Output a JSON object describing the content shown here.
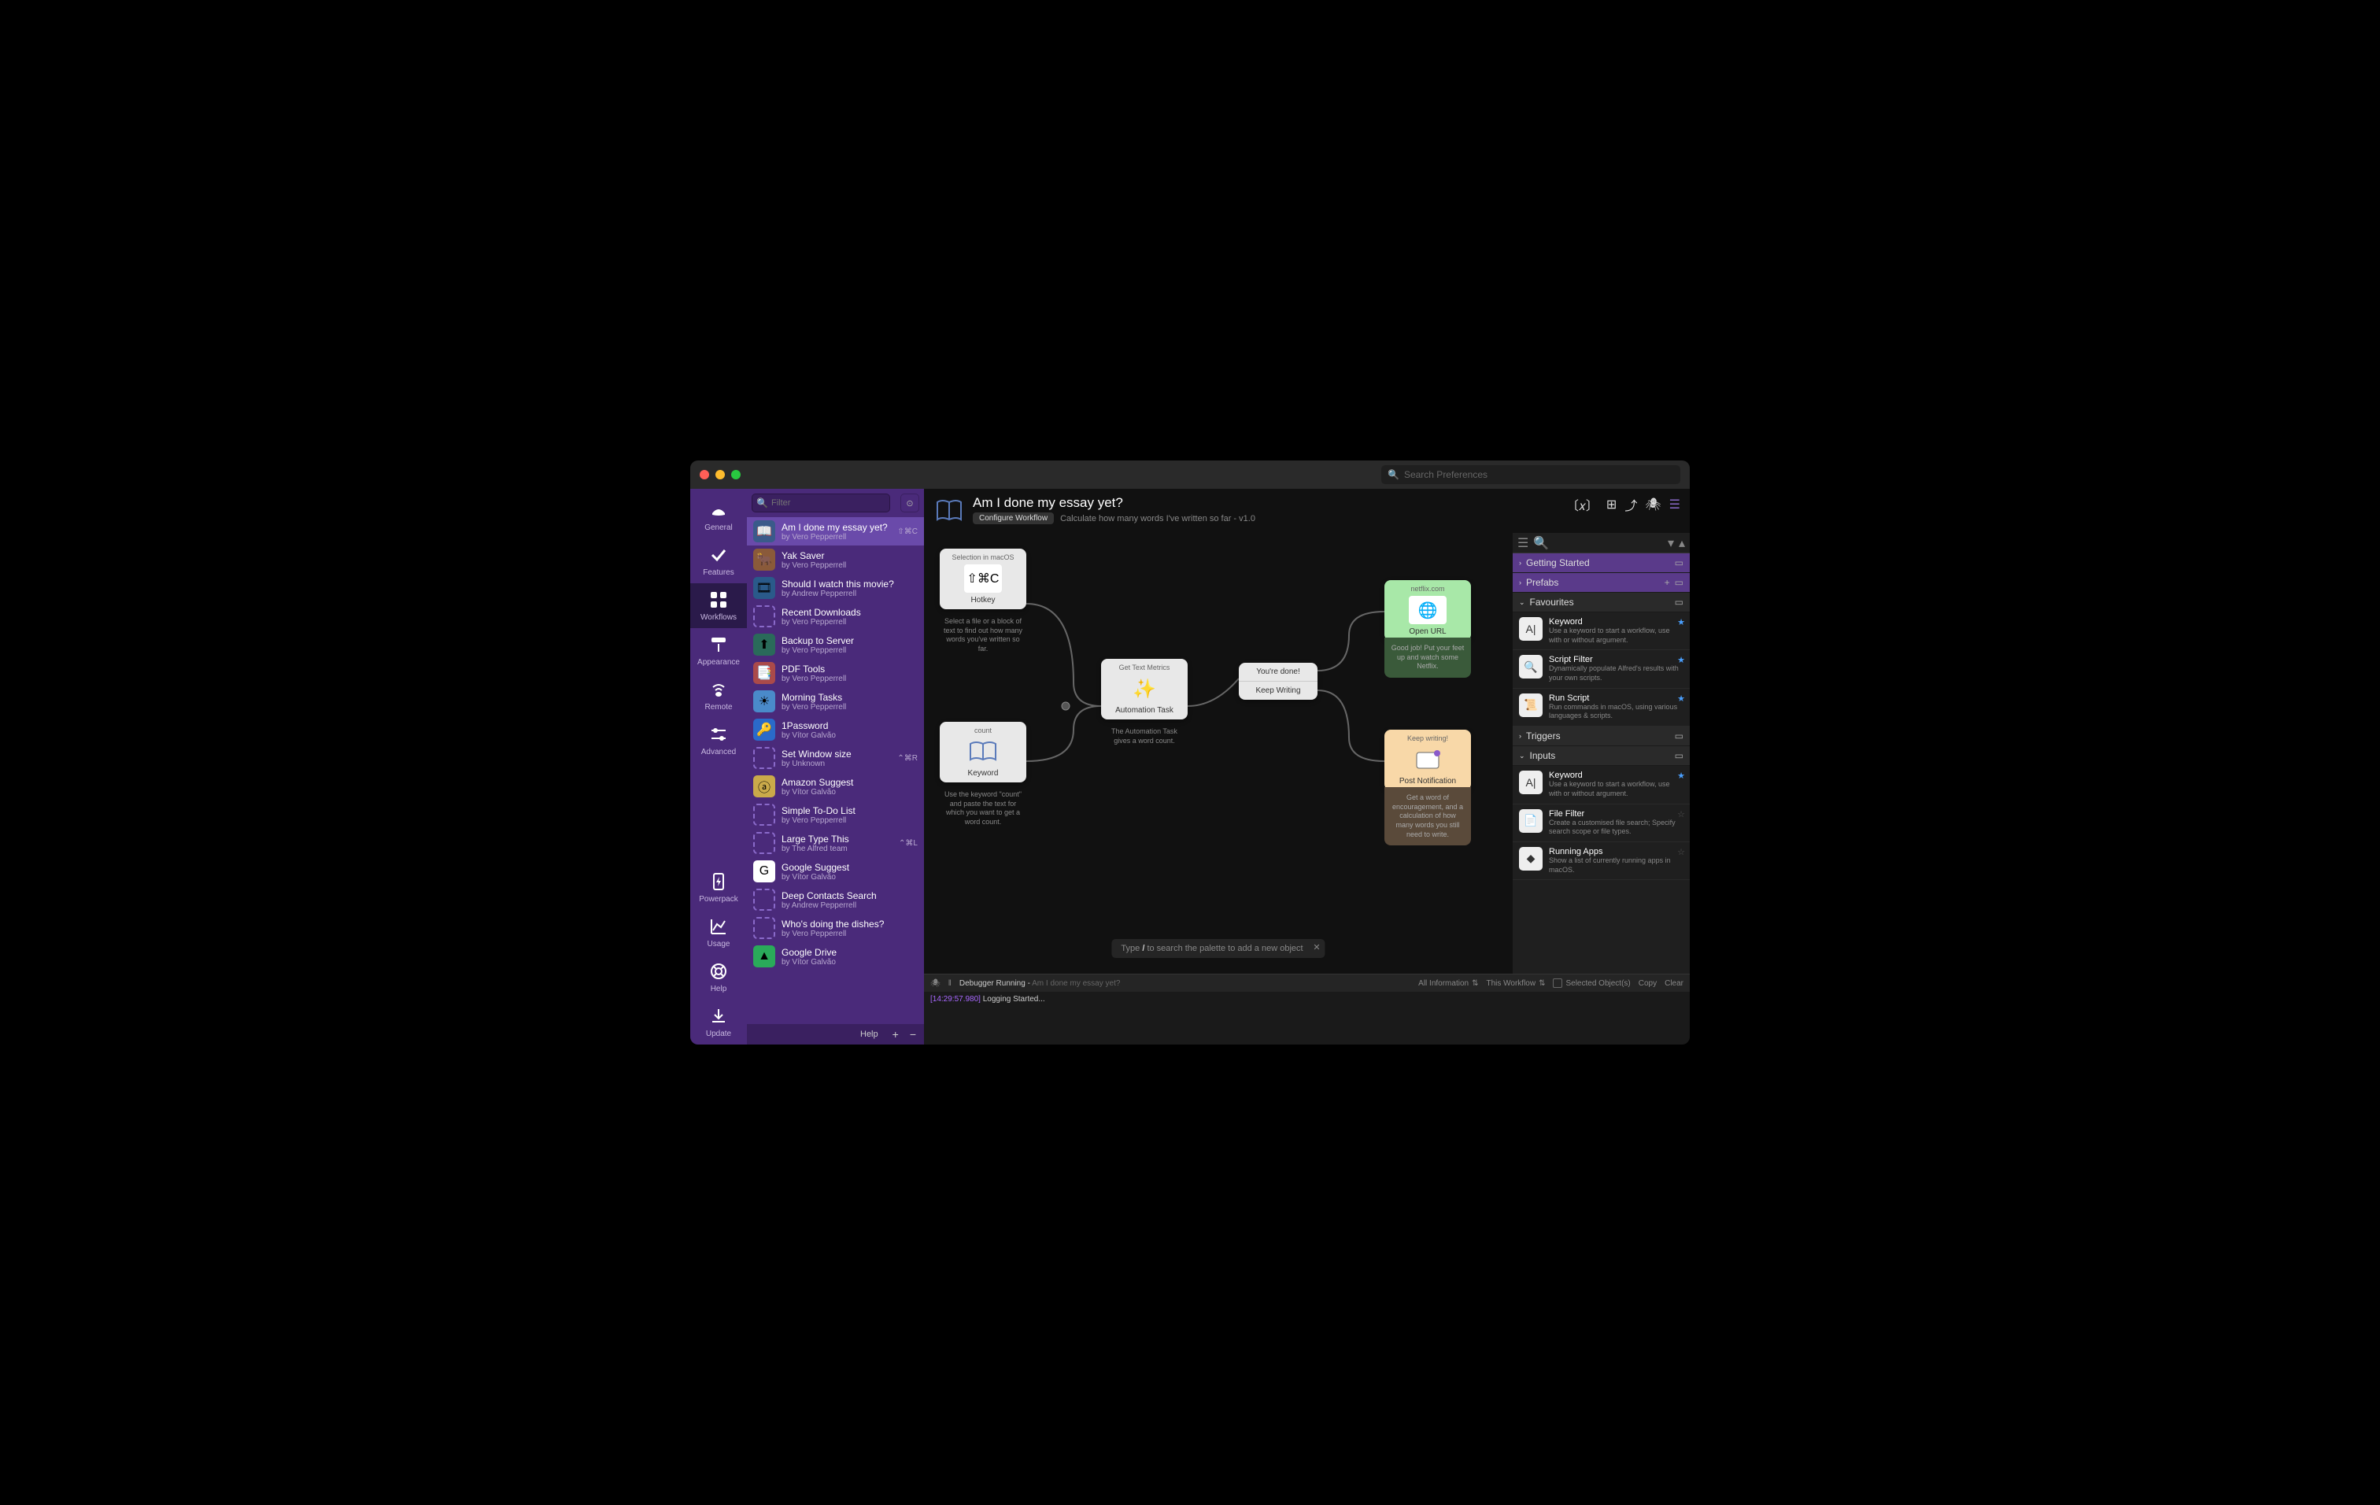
{
  "titlebar": {
    "search_placeholder": "Search Preferences"
  },
  "nav": [
    {
      "label": "General",
      "icon": "hat"
    },
    {
      "label": "Features",
      "icon": "check"
    },
    {
      "label": "Workflows",
      "icon": "grid",
      "active": true
    },
    {
      "label": "Appearance",
      "icon": "roller"
    },
    {
      "label": "Remote",
      "icon": "wifi"
    },
    {
      "label": "Advanced",
      "icon": "sliders"
    }
  ],
  "nav_bottom": [
    {
      "label": "Powerpack",
      "icon": "bolt"
    },
    {
      "label": "Usage",
      "icon": "chart"
    },
    {
      "label": "Help",
      "icon": "life"
    },
    {
      "label": "Update",
      "icon": "download"
    }
  ],
  "sidebar": {
    "filter_placeholder": "Filter",
    "help_label": "Help",
    "workflows": [
      {
        "title": "Am I done my essay yet?",
        "author": "by Vero Pepperrell",
        "icon": "book",
        "color": "#3a5a8a",
        "shortcut": "⇧⌘C",
        "selected": true
      },
      {
        "title": "Yak Saver",
        "author": "by Vero Pepperrell",
        "icon": "yak",
        "color": "#8a5a3a"
      },
      {
        "title": "Should I watch this movie?",
        "author": "by Andrew Pepperrell",
        "icon": "film",
        "color": "#2a5a8a"
      },
      {
        "title": "Recent Downloads",
        "author": "by Vero Pepperrell",
        "icon": "dashed"
      },
      {
        "title": "Backup to Server",
        "author": "by Vero Pepperrell",
        "icon": "upload",
        "color": "#2a6a5a"
      },
      {
        "title": "PDF Tools",
        "author": "by Vero Pepperrell",
        "icon": "pdf",
        "color": "#aa4a4a"
      },
      {
        "title": "Morning Tasks",
        "author": "by Vero Pepperrell",
        "icon": "sun",
        "color": "#4a8aca"
      },
      {
        "title": "1Password",
        "author": "by Vítor Galvão",
        "icon": "1p",
        "color": "#2a6aca"
      },
      {
        "title": "Set Window size",
        "author": "by Unknown",
        "icon": "dashed",
        "shortcut": "⌃⌘R"
      },
      {
        "title": "Amazon Suggest",
        "author": "by Vítor Galvão",
        "icon": "amazon",
        "color": "#caaa4a"
      },
      {
        "title": "Simple To-Do List",
        "author": "by Vero Pepperrell",
        "icon": "dashed"
      },
      {
        "title": "Large Type This",
        "author": "by The Alfred team",
        "icon": "dashed",
        "shortcut": "⌃⌘L"
      },
      {
        "title": "Google Suggest",
        "author": "by Vítor Galvão",
        "icon": "google",
        "color": "#fff"
      },
      {
        "title": "Deep Contacts Search",
        "author": "by Andrew Pepperrell",
        "icon": "dashed"
      },
      {
        "title": "Who's doing the dishes?",
        "author": "by Vero Pepperrell",
        "icon": "dashed"
      },
      {
        "title": "Google Drive",
        "author": "by Vítor Galvão",
        "icon": "drive",
        "color": "#2aaa5a"
      }
    ]
  },
  "header": {
    "title": "Am I done my essay yet?",
    "configure": "Configure Workflow",
    "description": "Calculate how many words I've written so far - v1.0"
  },
  "nodes": {
    "hotkey": {
      "subtitle": "Selection in macOS",
      "content": "⇧⌘C",
      "label": "Hotkey",
      "desc": "Select a file or a block of text to find out how many words you've written so far."
    },
    "keyword": {
      "subtitle": "count",
      "label": "Keyword",
      "desc": "Use the keyword \"count\" and paste the text for which you want to get a word count."
    },
    "automation": {
      "subtitle": "Get Text Metrics",
      "label": "Automation Task",
      "desc": "The Automation Task gives a word count."
    },
    "decision": {
      "opt1": "You're done!",
      "opt2": "Keep Writing"
    },
    "openurl": {
      "subtitle": "netflix.com",
      "label": "Open URL",
      "desc": "Good job! Put your feet up and watch some Netflix."
    },
    "notify": {
      "subtitle": "Keep writing!",
      "label": "Post Notification",
      "desc": "Get a word of encouragement, and a calculation of how many words you still need to write."
    }
  },
  "palette_hint": {
    "pre": "Type ",
    "key": "/",
    "post": " to search the palette to add a new object"
  },
  "inspector": {
    "sections": {
      "getting_started": "Getting Started",
      "prefabs": "Prefabs",
      "favourites": "Favourites",
      "triggers": "Triggers",
      "inputs": "Inputs"
    },
    "fav": [
      {
        "title": "Keyword",
        "desc": "Use a keyword to start a workflow, use with or without argument.",
        "icon": "A|",
        "star": true
      },
      {
        "title": "Script Filter",
        "desc": "Dynamically populate Alfred's results with your own scripts.",
        "icon": "🔍",
        "star": true
      },
      {
        "title": "Run Script",
        "desc": "Run commands in macOS, using various languages & scripts.",
        "icon": "📜",
        "star": true
      }
    ],
    "inputs": [
      {
        "title": "Keyword",
        "desc": "Use a keyword to start a workflow, use with or without argument.",
        "icon": "A|",
        "star": true
      },
      {
        "title": "File Filter",
        "desc": "Create a customised file search; Specify search scope or file types.",
        "icon": "📄",
        "star": false
      },
      {
        "title": "Running Apps",
        "desc": "Show a list of currently running apps in macOS.",
        "icon": "◆",
        "star": false
      }
    ]
  },
  "debugger": {
    "status": "Debugger Running",
    "context": "Am I done my essay yet?",
    "filter1": "All Information",
    "filter2": "This Workflow",
    "selected": "Selected Object(s)",
    "copy": "Copy",
    "clear": "Clear",
    "timestamp": "[14:29:57.980]",
    "message": "Logging Started..."
  }
}
